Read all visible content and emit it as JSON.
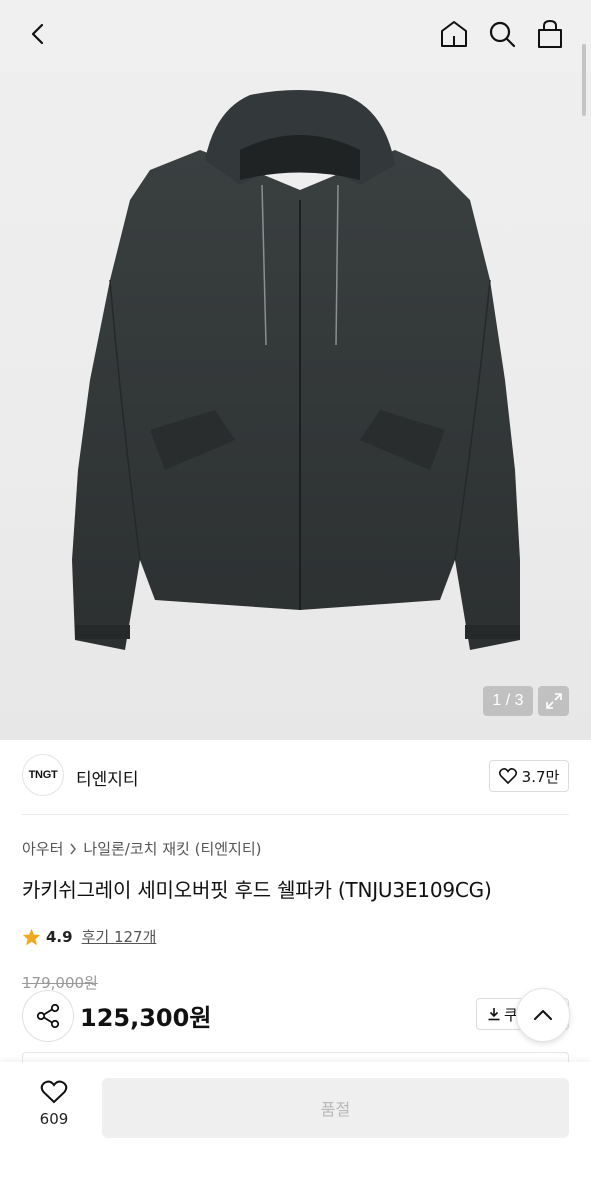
{
  "header": {
    "back_icon": "chevron-left-icon",
    "home_icon": "home-icon",
    "search_icon": "search-icon",
    "cart_icon": "shopping-bag-icon"
  },
  "gallery": {
    "image_alt": "카키쉬그레이 세미오버핏 후드 쉘파카 product photo",
    "counter": "1 / 3",
    "expand_icon": "expand-icon"
  },
  "brand": {
    "logo_text": "TNGT",
    "name": "티엔지티",
    "like_count": "3.7만"
  },
  "product": {
    "breadcrumb_parent": "아우터",
    "breadcrumb_child": "나일론/코치 재킷 (티엔지티)",
    "title": "카키쉬그레이 세미오버핏 후드 쉘파카 (TNJU3E109CG)",
    "rating": "4.9",
    "review_label": "후기 127개",
    "original_price": "179,000원",
    "sale_price": "125,300원",
    "coupon_label": "쿠"
  },
  "bottom_bar": {
    "wish_count": "609",
    "buy_button_label": "품절"
  },
  "colors": {
    "star": "#f2a91d",
    "soldout_bg": "#efefef",
    "soldout_text": "#b8b8b8"
  }
}
